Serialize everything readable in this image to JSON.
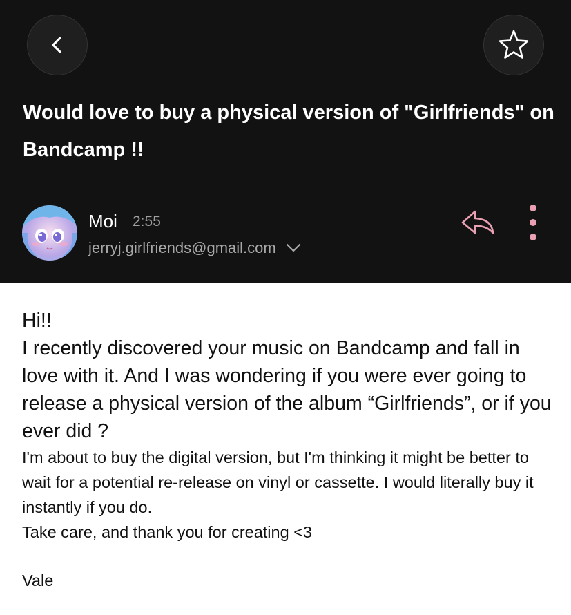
{
  "header": {
    "back_icon": "chevron-left-icon",
    "star_icon": "star-outline-icon"
  },
  "subject": "Would love to buy a physical version of \"Girlfriends\" on Bandcamp !!",
  "sender": {
    "name": "Moi",
    "time": "2:55",
    "email": "jerryj.girlfriends@gmail.com",
    "expand_icon": "chevron-down-icon",
    "reply_icon": "reply-icon",
    "more_icon": "more-vertical-icon",
    "accent_color": "#e8a0b2"
  },
  "message": {
    "greeting": "Hi!!",
    "paragraph_1": "I recently discovered your music on Bandcamp and fall in love with it. And I was wondering if you were ever going to release a physical version of the album “Girlfriends”, or if you ever did ?",
    "paragraph_2": "I'm about to buy the digital version, but I'm thinking it might be better to wait for a potential re-release on vinyl or cassette. I would literally buy it instantly if you do.",
    "paragraph_3": "Take care, and thank you for creating <3",
    "signature": "Vale"
  }
}
